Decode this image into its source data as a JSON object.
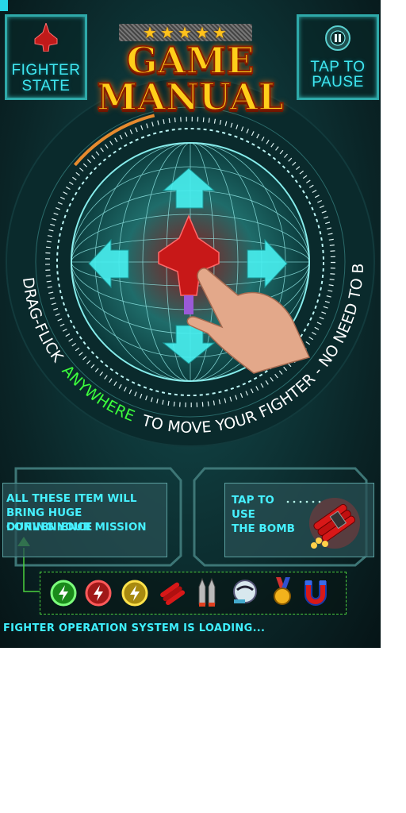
{
  "header": {
    "fighter_state_line1": "FIGHTER",
    "fighter_state_line2": "STATE",
    "pause_line1": "TAP TO",
    "pause_line2": "PAUSE",
    "pause_icon": "pause-icon",
    "fighter_icon": "fighter-jet-icon"
  },
  "title": {
    "line1": "GAME",
    "line2": "MANUAL",
    "stars": [
      "★",
      "★",
      "★",
      "★",
      "★"
    ]
  },
  "control": {
    "instruction_part1": "DRAG-FLICK",
    "instruction_highlight": "ANYWHERE",
    "instruction_part2": "TO MOVE YOUR FIGHTER - NO NEED TO BE RIGHT ON IT",
    "arrows": [
      "up-arrow-icon",
      "down-arrow-icon",
      "left-arrow-icon",
      "right-arrow-icon"
    ],
    "hand_icon": "pointing-hand-icon"
  },
  "panels": {
    "items_line1": "ALL THESE ITEM WILL",
    "items_line2": "BRING HUGE CONVENIENCE",
    "items_line3": "DURING YOUR MISSION",
    "bomb_line1": "TAP TO",
    "bomb_line2": "USE",
    "bomb_line3": "THE BOMB",
    "bomb_icon": "dynamite-bomb-icon"
  },
  "items": [
    {
      "name": "green-power-icon"
    },
    {
      "name": "red-power-icon"
    },
    {
      "name": "yellow-power-icon"
    },
    {
      "name": "dynamite-icon"
    },
    {
      "name": "missiles-icon"
    },
    {
      "name": "shield-orb-icon"
    },
    {
      "name": "medal-icon"
    },
    {
      "name": "magnet-icon"
    }
  ],
  "status": {
    "loading": "FIGHTER OPERATION SYSTEM IS LOADING..."
  },
  "colors": {
    "accent_cyan": "#3fe6f0",
    "highlight_green": "#3cff3c",
    "title_gold": "#ffce1a"
  }
}
